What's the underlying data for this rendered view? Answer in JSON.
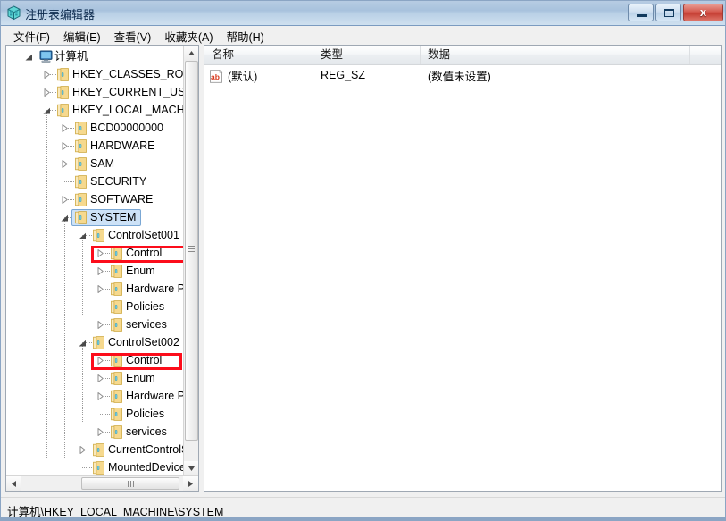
{
  "window": {
    "title": "注册表编辑器",
    "icon": "registry-editor-icon"
  },
  "titlebar_buttons": {
    "minimize": "minimize-icon",
    "maximize": "maximize-icon",
    "close": "x"
  },
  "menu": {
    "items": [
      {
        "label": "文件(F)",
        "name": "menu-file"
      },
      {
        "label": "编辑(E)",
        "name": "menu-edit"
      },
      {
        "label": "查看(V)",
        "name": "menu-view"
      },
      {
        "label": "收藏夹(A)",
        "name": "menu-favorites"
      },
      {
        "label": "帮助(H)",
        "name": "menu-help"
      }
    ]
  },
  "tree": {
    "nodes": [
      {
        "label": "计算机",
        "depth": 0,
        "state": "expanded",
        "icon": "computer-icon",
        "selected": false,
        "highlight": false
      },
      {
        "label": "HKEY_CLASSES_ROOT",
        "depth": 1,
        "state": "collapsed",
        "icon": "folder-icon",
        "selected": false,
        "highlight": false
      },
      {
        "label": "HKEY_CURRENT_USER",
        "depth": 1,
        "state": "collapsed",
        "icon": "folder-icon",
        "selected": false,
        "highlight": false
      },
      {
        "label": "HKEY_LOCAL_MACHINE",
        "depth": 1,
        "state": "expanded",
        "icon": "folder-icon",
        "selected": false,
        "highlight": false
      },
      {
        "label": "BCD00000000",
        "depth": 2,
        "state": "collapsed",
        "icon": "folder-icon",
        "selected": false,
        "highlight": false
      },
      {
        "label": "HARDWARE",
        "depth": 2,
        "state": "collapsed",
        "icon": "folder-icon",
        "selected": false,
        "highlight": false
      },
      {
        "label": "SAM",
        "depth": 2,
        "state": "collapsed",
        "icon": "folder-icon",
        "selected": false,
        "highlight": false
      },
      {
        "label": "SECURITY",
        "depth": 2,
        "state": "leaf",
        "icon": "folder-icon",
        "selected": false,
        "highlight": false
      },
      {
        "label": "SOFTWARE",
        "depth": 2,
        "state": "collapsed",
        "icon": "folder-icon",
        "selected": false,
        "highlight": false
      },
      {
        "label": "SYSTEM",
        "depth": 2,
        "state": "expanded",
        "icon": "folder-icon",
        "selected": true,
        "highlight": false
      },
      {
        "label": "ControlSet001",
        "depth": 3,
        "state": "expanded",
        "icon": "folder-icon",
        "selected": false,
        "highlight": false
      },
      {
        "label": "Control",
        "depth": 4,
        "state": "collapsed",
        "icon": "folder-icon",
        "selected": false,
        "highlight": true
      },
      {
        "label": "Enum",
        "depth": 4,
        "state": "collapsed",
        "icon": "folder-icon",
        "selected": false,
        "highlight": false
      },
      {
        "label": "Hardware Pro",
        "depth": 4,
        "state": "collapsed",
        "icon": "folder-icon",
        "selected": false,
        "highlight": false
      },
      {
        "label": "Policies",
        "depth": 4,
        "state": "leaf",
        "icon": "folder-icon",
        "selected": false,
        "highlight": false
      },
      {
        "label": "services",
        "depth": 4,
        "state": "collapsed",
        "icon": "folder-icon",
        "selected": false,
        "highlight": false
      },
      {
        "label": "ControlSet002",
        "depth": 3,
        "state": "expanded",
        "icon": "folder-icon",
        "selected": false,
        "highlight": false
      },
      {
        "label": "Control",
        "depth": 4,
        "state": "collapsed",
        "icon": "folder-icon",
        "selected": false,
        "highlight": true
      },
      {
        "label": "Enum",
        "depth": 4,
        "state": "collapsed",
        "icon": "folder-icon",
        "selected": false,
        "highlight": false
      },
      {
        "label": "Hardware Pro",
        "depth": 4,
        "state": "collapsed",
        "icon": "folder-icon",
        "selected": false,
        "highlight": false
      },
      {
        "label": "Policies",
        "depth": 4,
        "state": "leaf",
        "icon": "folder-icon",
        "selected": false,
        "highlight": false
      },
      {
        "label": "services",
        "depth": 4,
        "state": "collapsed",
        "icon": "folder-icon",
        "selected": false,
        "highlight": false
      },
      {
        "label": "CurrentControlS",
        "depth": 3,
        "state": "collapsed",
        "icon": "folder-icon",
        "selected": false,
        "highlight": false
      },
      {
        "label": "MountedDevices",
        "depth": 3,
        "state": "leaf",
        "icon": "folder-icon",
        "selected": false,
        "highlight": false
      }
    ]
  },
  "list": {
    "columns": [
      "名称",
      "类型",
      "数据"
    ],
    "rows": [
      {
        "name": "(默认)",
        "type": "REG_SZ",
        "data": "(数值未设置)",
        "icon": "string-value-icon"
      }
    ]
  },
  "statusbar": {
    "path": "计算机\\HKEY_LOCAL_MACHINE\\SYSTEM"
  },
  "colors": {
    "highlight_box": "#fc0d1b",
    "selection": "#cde2f7",
    "titlebar": "#b7cce3",
    "close_button": "#c3392e",
    "folder": "#f5d88a"
  }
}
